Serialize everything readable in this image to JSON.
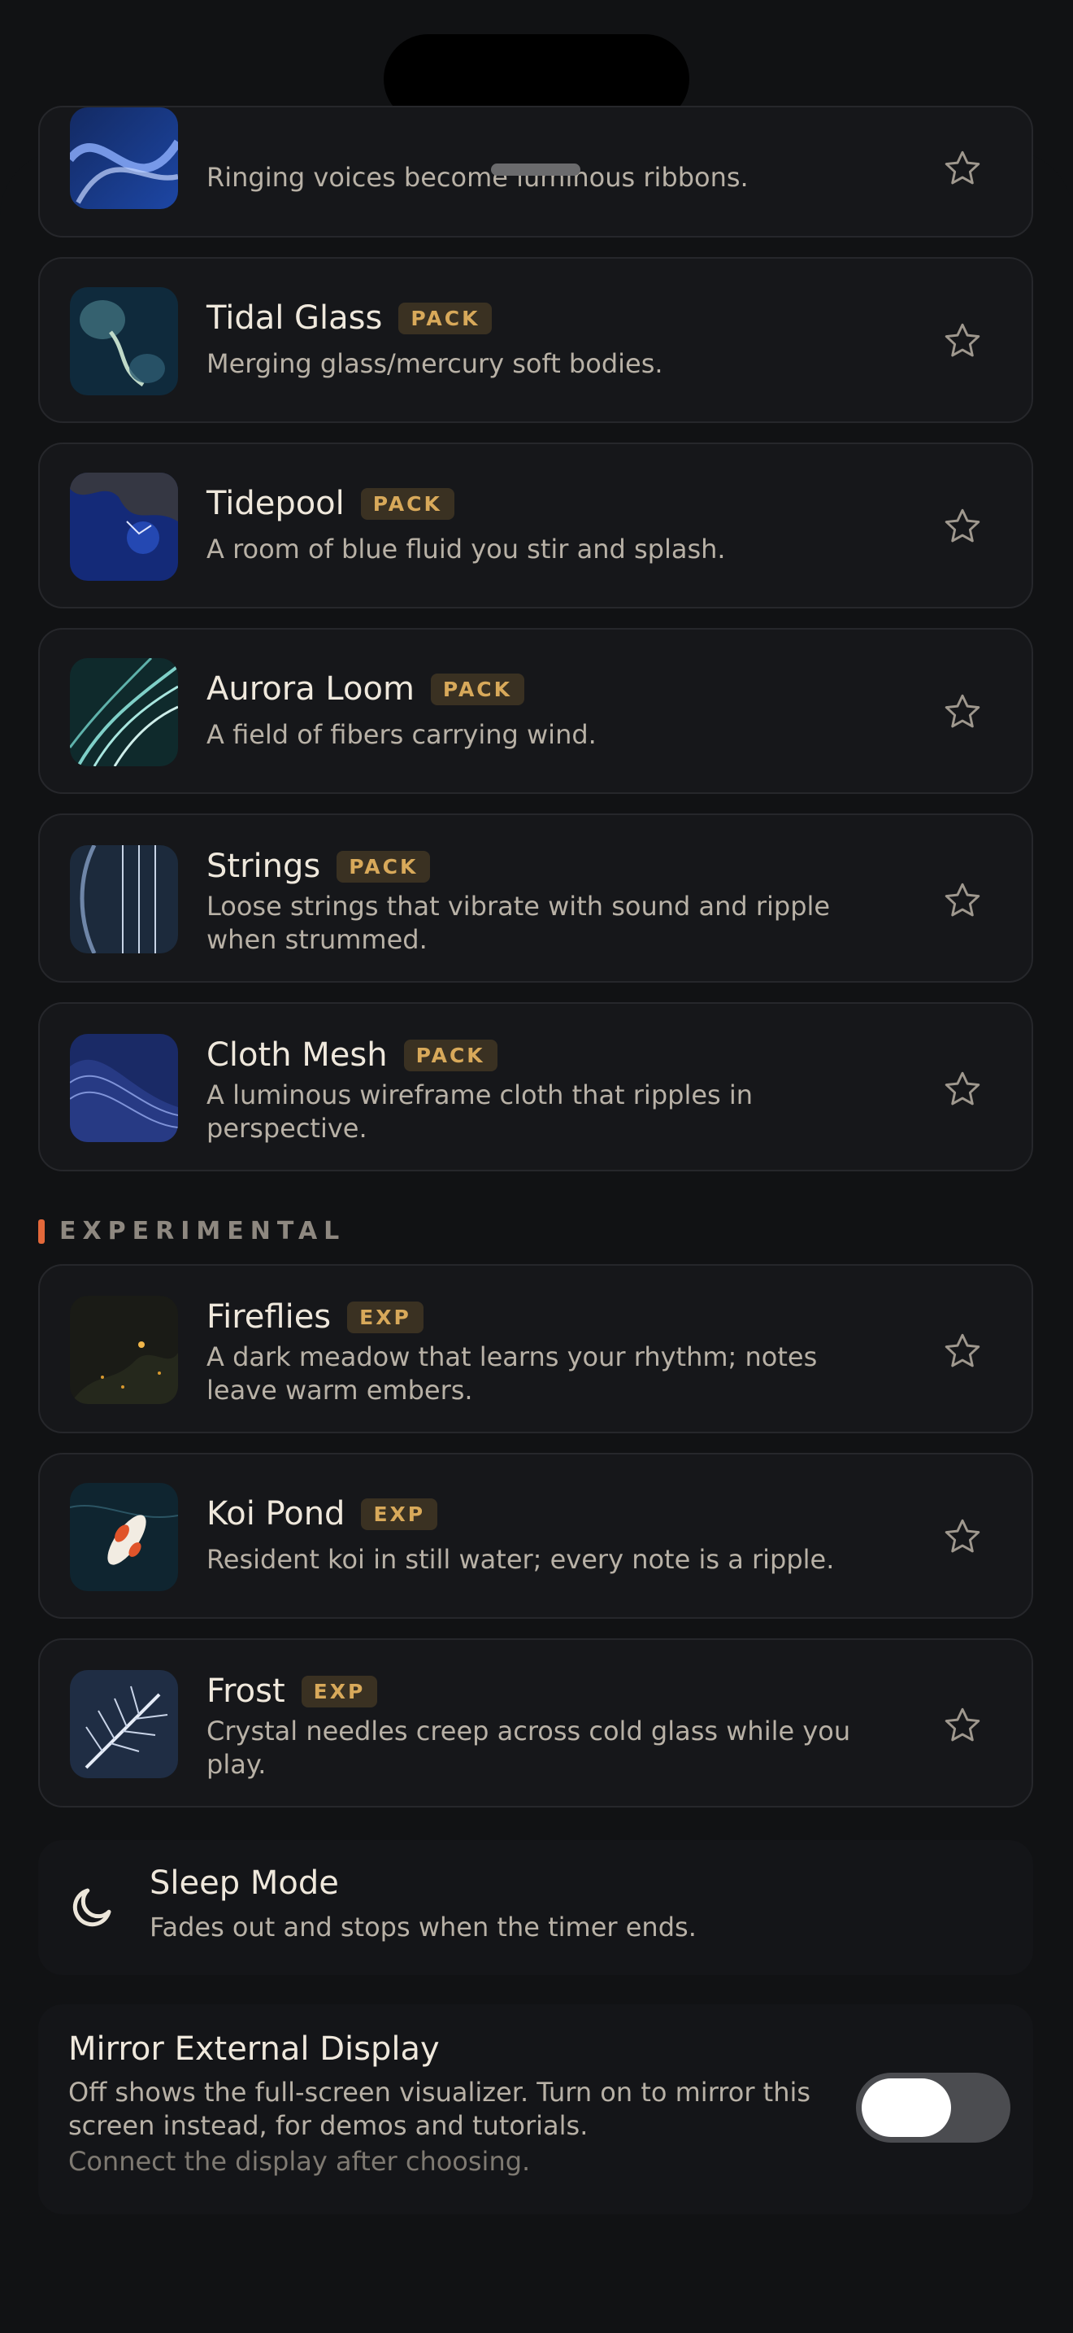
{
  "items": [
    {
      "title": "",
      "badge": "",
      "desc": "Ringing voices become luminous ribbons.",
      "icon": "star-outline-icon"
    },
    {
      "title": "Tidal Glass",
      "badge": "PACK",
      "desc": "Merging glass/mercury soft bodies.",
      "icon": "star-outline-icon"
    },
    {
      "title": "Tidepool",
      "badge": "PACK",
      "desc": "A room of blue fluid you stir and splash.",
      "icon": "star-outline-icon"
    },
    {
      "title": "Aurora Loom",
      "badge": "PACK",
      "desc": "A field of fibers carrying wind.",
      "icon": "star-outline-icon"
    },
    {
      "title": "Strings",
      "badge": "PACK",
      "desc": "Loose strings that vibrate with sound and ripple when strummed.",
      "icon": "star-outline-icon"
    },
    {
      "title": "Cloth Mesh",
      "badge": "PACK",
      "desc": "A luminous wireframe cloth that ripples in perspective.",
      "icon": "star-outline-icon"
    }
  ],
  "experimental": {
    "label": "EXPERIMENTAL",
    "accent": "#e3683a",
    "items": [
      {
        "title": "Fireflies",
        "badge": "EXP",
        "desc": "A dark meadow that learns your rhythm; notes leave warm embers.",
        "icon": "star-outline-icon"
      },
      {
        "title": "Koi Pond",
        "badge": "EXP",
        "desc": "Resident koi in still water; every note is a ripple.",
        "icon": "star-outline-icon"
      },
      {
        "title": "Frost",
        "badge": "EXP",
        "desc": "Crystal needles creep across cold glass while you play.",
        "icon": "star-outline-icon"
      }
    ]
  },
  "sleep_mode": {
    "title": "Sleep Mode",
    "desc": "Fades out and stops when the timer ends.",
    "icon": "moon-icon"
  },
  "mirror_display": {
    "title": "Mirror External Display",
    "desc": "Off shows the full-screen visualizer. Turn on to mirror this screen instead, for demos and tutorials.",
    "note": "Connect the display after choosing.",
    "toggle_on": false
  },
  "colors": {
    "badge_text": "#d8a95a",
    "badge_bg": "#3a3122",
    "background": "#111214"
  }
}
